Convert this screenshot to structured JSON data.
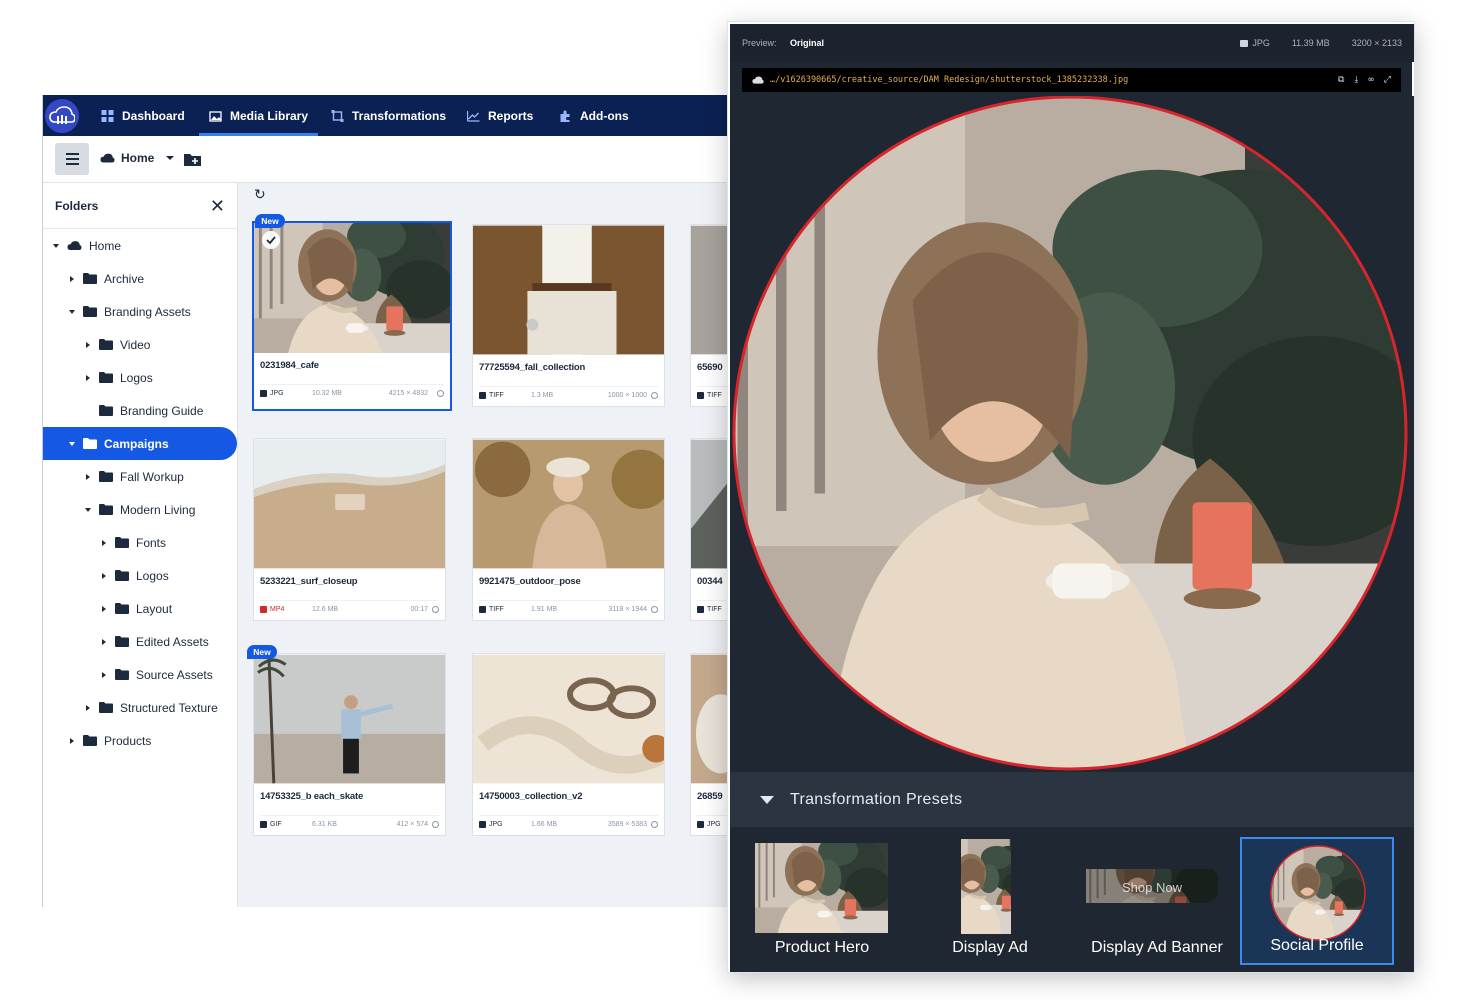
{
  "nav": {
    "items": [
      {
        "label": "Dashboard",
        "icon": "dashboard-icon"
      },
      {
        "label": "Media Library",
        "icon": "media-library-icon"
      },
      {
        "label": "Transformations",
        "icon": "transformations-icon"
      },
      {
        "label": "Reports",
        "icon": "reports-icon"
      },
      {
        "label": "Add-ons",
        "icon": "addons-icon"
      }
    ],
    "active": "Media Library"
  },
  "toolbar": {
    "breadcrumb": "Home"
  },
  "sidebar": {
    "title": "Folders",
    "tree": [
      {
        "label": "Home",
        "level": 0,
        "state": "expanded",
        "icon": "cloud-icon"
      },
      {
        "label": "Archive",
        "level": 1,
        "state": "collapsed"
      },
      {
        "label": "Branding Assets",
        "level": 1,
        "state": "expanded"
      },
      {
        "label": "Video",
        "level": 2,
        "state": "collapsed"
      },
      {
        "label": "Logos",
        "level": 2,
        "state": "collapsed"
      },
      {
        "label": "Branding Guide",
        "level": 2,
        "state": "leaf"
      },
      {
        "label": "Campaigns",
        "level": 1,
        "state": "expanded",
        "selected": true
      },
      {
        "label": "Fall Workup",
        "level": 2,
        "state": "collapsed"
      },
      {
        "label": "Modern Living",
        "level": 2,
        "state": "expanded"
      },
      {
        "label": "Fonts",
        "level": 3,
        "state": "collapsed"
      },
      {
        "label": "Logos",
        "level": 3,
        "state": "collapsed"
      },
      {
        "label": "Layout",
        "level": 3,
        "state": "collapsed"
      },
      {
        "label": "Edited Assets",
        "level": 3,
        "state": "collapsed"
      },
      {
        "label": "Source Assets",
        "level": 3,
        "state": "collapsed"
      },
      {
        "label": "Structured Texture",
        "level": 2,
        "state": "collapsed"
      },
      {
        "label": "Products",
        "level": 1,
        "state": "collapsed"
      }
    ]
  },
  "assets": [
    {
      "name": "0231984_cafe",
      "type": "JPG",
      "size": "10.32 MB",
      "dims": "4215 × 4832",
      "badge": "New",
      "selected": true
    },
    {
      "name": "77725594_fall_collection",
      "type": "TIFF",
      "size": "1.3 MB",
      "dims": "1000 × 1000"
    },
    {
      "name": "65690",
      "type": "TIFF",
      "size": "",
      "dims": ""
    },
    {
      "name": "5233221_surf_closeup",
      "type": "MP4",
      "size": "12.6 MB",
      "dims": "00:17"
    },
    {
      "name": "9921475_outdoor_pose",
      "type": "TIFF",
      "size": "1.91 MB",
      "dims": "3118 × 1944"
    },
    {
      "name": "00344",
      "type": "TIFF",
      "size": "",
      "dims": ""
    },
    {
      "name": "14753325_b each_skate",
      "type": "GIF",
      "size": "6.31 KB",
      "dims": "412 × 574",
      "badge": "New"
    },
    {
      "name": "14750003_collection_v2",
      "type": "JPG",
      "size": "1.66 MB",
      "dims": "3589 × 5383"
    },
    {
      "name": "26859",
      "type": "JPG",
      "size": "",
      "dims": ""
    }
  ],
  "preview": {
    "label": "Preview:",
    "mode": "Original",
    "filetype": "JPG",
    "filesize": "11.39 MB",
    "dimensions": "3200 × 2133",
    "url": "…/v1626390665/creative_source/DAM Redesign/shutterstock_1385232338.jpg",
    "url_actions": [
      "open-external-icon",
      "download-icon",
      "link-icon",
      "expand-icon"
    ]
  },
  "presets": {
    "title": "Transformation Presets",
    "items": [
      {
        "label": "Product Hero"
      },
      {
        "label": "Display Ad"
      },
      {
        "label": "Display Ad Banner",
        "overlay_text": "Shop Now"
      },
      {
        "label": "Social Profile",
        "selected": true
      }
    ]
  },
  "colors": {
    "nav_bg": "#0c2153",
    "accent": "#1458e3",
    "preview_bg": "#1f2733",
    "circle_outline": "#d8252c",
    "url_text": "#e8b04a"
  }
}
